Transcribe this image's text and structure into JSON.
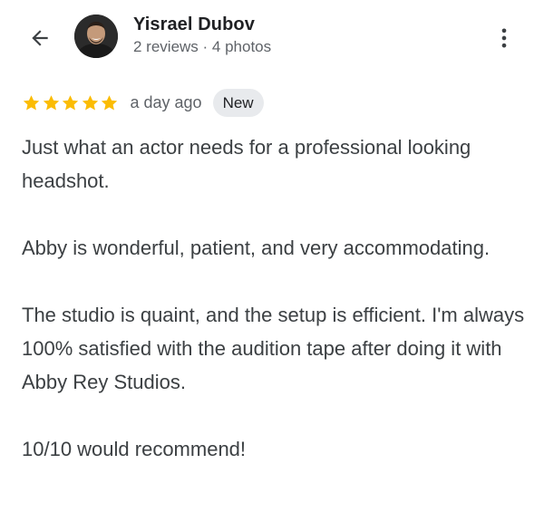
{
  "header": {
    "back_icon": "arrow-left-icon",
    "user_name": "Yisrael Dubov",
    "user_meta": "2 reviews · 4 photos",
    "more_icon": "more-vert-icon"
  },
  "review": {
    "rating": 5,
    "rating_max": 5,
    "star_color": "#fbbc04",
    "date": "a day ago",
    "badge": "New",
    "paragraphs": [
      "Just what an actor needs for a professional looking headshot.",
      "Abby is wonderful, patient, and very accommodating.",
      "The studio is quaint, and the setup is efficient. I'm always 100% satisfied with the audition tape after doing it with Abby Rey Studios.",
      "10/10 would recommend!"
    ]
  }
}
